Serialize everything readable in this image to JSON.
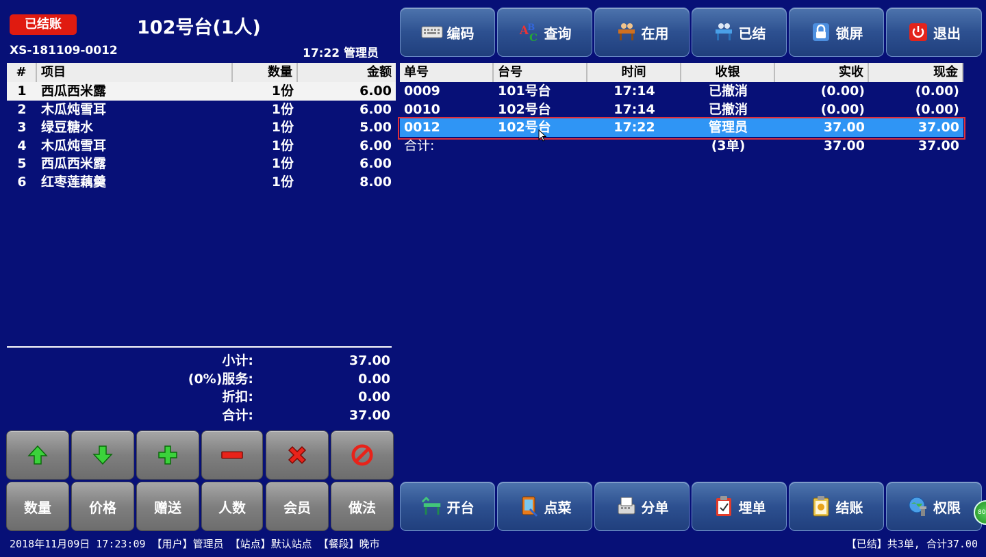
{
  "header": {
    "status_badge": "已结账",
    "table_title": "102号台(1人)",
    "order_no": "XS-181109-0012",
    "time_user": "17:22 管理员"
  },
  "order_items": {
    "columns": [
      "#",
      "项目",
      "数量",
      "金额"
    ],
    "rows": [
      {
        "no": "1",
        "item": "西瓜西米露",
        "qty": "1份",
        "amount": "6.00"
      },
      {
        "no": "2",
        "item": "木瓜炖雪耳",
        "qty": "1份",
        "amount": "6.00"
      },
      {
        "no": "3",
        "item": "绿豆糖水",
        "qty": "1份",
        "amount": "5.00"
      },
      {
        "no": "4",
        "item": "木瓜炖雪耳",
        "qty": "1份",
        "amount": "6.00"
      },
      {
        "no": "5",
        "item": "西瓜西米露",
        "qty": "1份",
        "amount": "6.00"
      },
      {
        "no": "6",
        "item": "红枣莲藕羹",
        "qty": "1份",
        "amount": "8.00"
      }
    ]
  },
  "totals": {
    "subtotal_label": "小计:",
    "subtotal": "37.00",
    "service_label": "(0%)服务:",
    "service": "0.00",
    "discount_label": "折扣:",
    "discount": "0.00",
    "total_label": "合计:",
    "total": "37.00"
  },
  "top_buttons": [
    {
      "label": "编码",
      "icon": "keyboard-icon"
    },
    {
      "label": "查询",
      "icon": "abc-search-icon"
    },
    {
      "label": "在用",
      "icon": "dining-occupied-icon"
    },
    {
      "label": "已结",
      "icon": "dining-settled-icon"
    },
    {
      "label": "锁屏",
      "icon": "lock-icon"
    },
    {
      "label": "退出",
      "icon": "power-icon"
    }
  ],
  "bills": {
    "columns": [
      "单号",
      "台号",
      "时间",
      "收银",
      "实收",
      "现金"
    ],
    "rows": [
      {
        "no": "0009",
        "table": "101号台",
        "time": "17:14",
        "cashier": "已撤消",
        "received": "(0.00)",
        "cash": "(0.00)"
      },
      {
        "no": "0010",
        "table": "102号台",
        "time": "17:14",
        "cashier": "已撤消",
        "received": "(0.00)",
        "cash": "(0.00)"
      },
      {
        "no": "0012",
        "table": "102号台",
        "time": "17:22",
        "cashier": "管理员",
        "received": "37.00",
        "cash": "37.00"
      }
    ],
    "summary": {
      "label": "合计:",
      "count": "(3单)",
      "received": "37.00",
      "cash": "37.00"
    }
  },
  "edit_buttons": [
    {
      "icon": "arrow-up-icon"
    },
    {
      "icon": "arrow-down-icon"
    },
    {
      "icon": "plus-icon"
    },
    {
      "icon": "minus-icon"
    },
    {
      "icon": "delete-x-icon"
    },
    {
      "icon": "cancel-icon"
    }
  ],
  "function_buttons": [
    "数量",
    "价格",
    "赠送",
    "人数",
    "会员",
    "做法"
  ],
  "bottom_buttons": [
    {
      "label": "开台",
      "icon": "open-table-icon"
    },
    {
      "label": "点菜",
      "icon": "order-dish-icon"
    },
    {
      "label": "分单",
      "icon": "split-bill-icon"
    },
    {
      "label": "埋单",
      "icon": "clipboard-icon"
    },
    {
      "label": "结账",
      "icon": "checkout-icon"
    },
    {
      "label": "权限",
      "icon": "permission-icon"
    }
  ],
  "footer": {
    "left": "2018年11月09日 17:23:09 【用户】管理员 【站点】默认站点 【餐段】晚市",
    "right": "【已结】共3单, 合计37.00"
  },
  "corner_badge": "80",
  "colors": {
    "background": "#071077",
    "status_red": "#e01b10",
    "selection_blue": "#2f95f5",
    "selection_outline": "#e0303a"
  }
}
